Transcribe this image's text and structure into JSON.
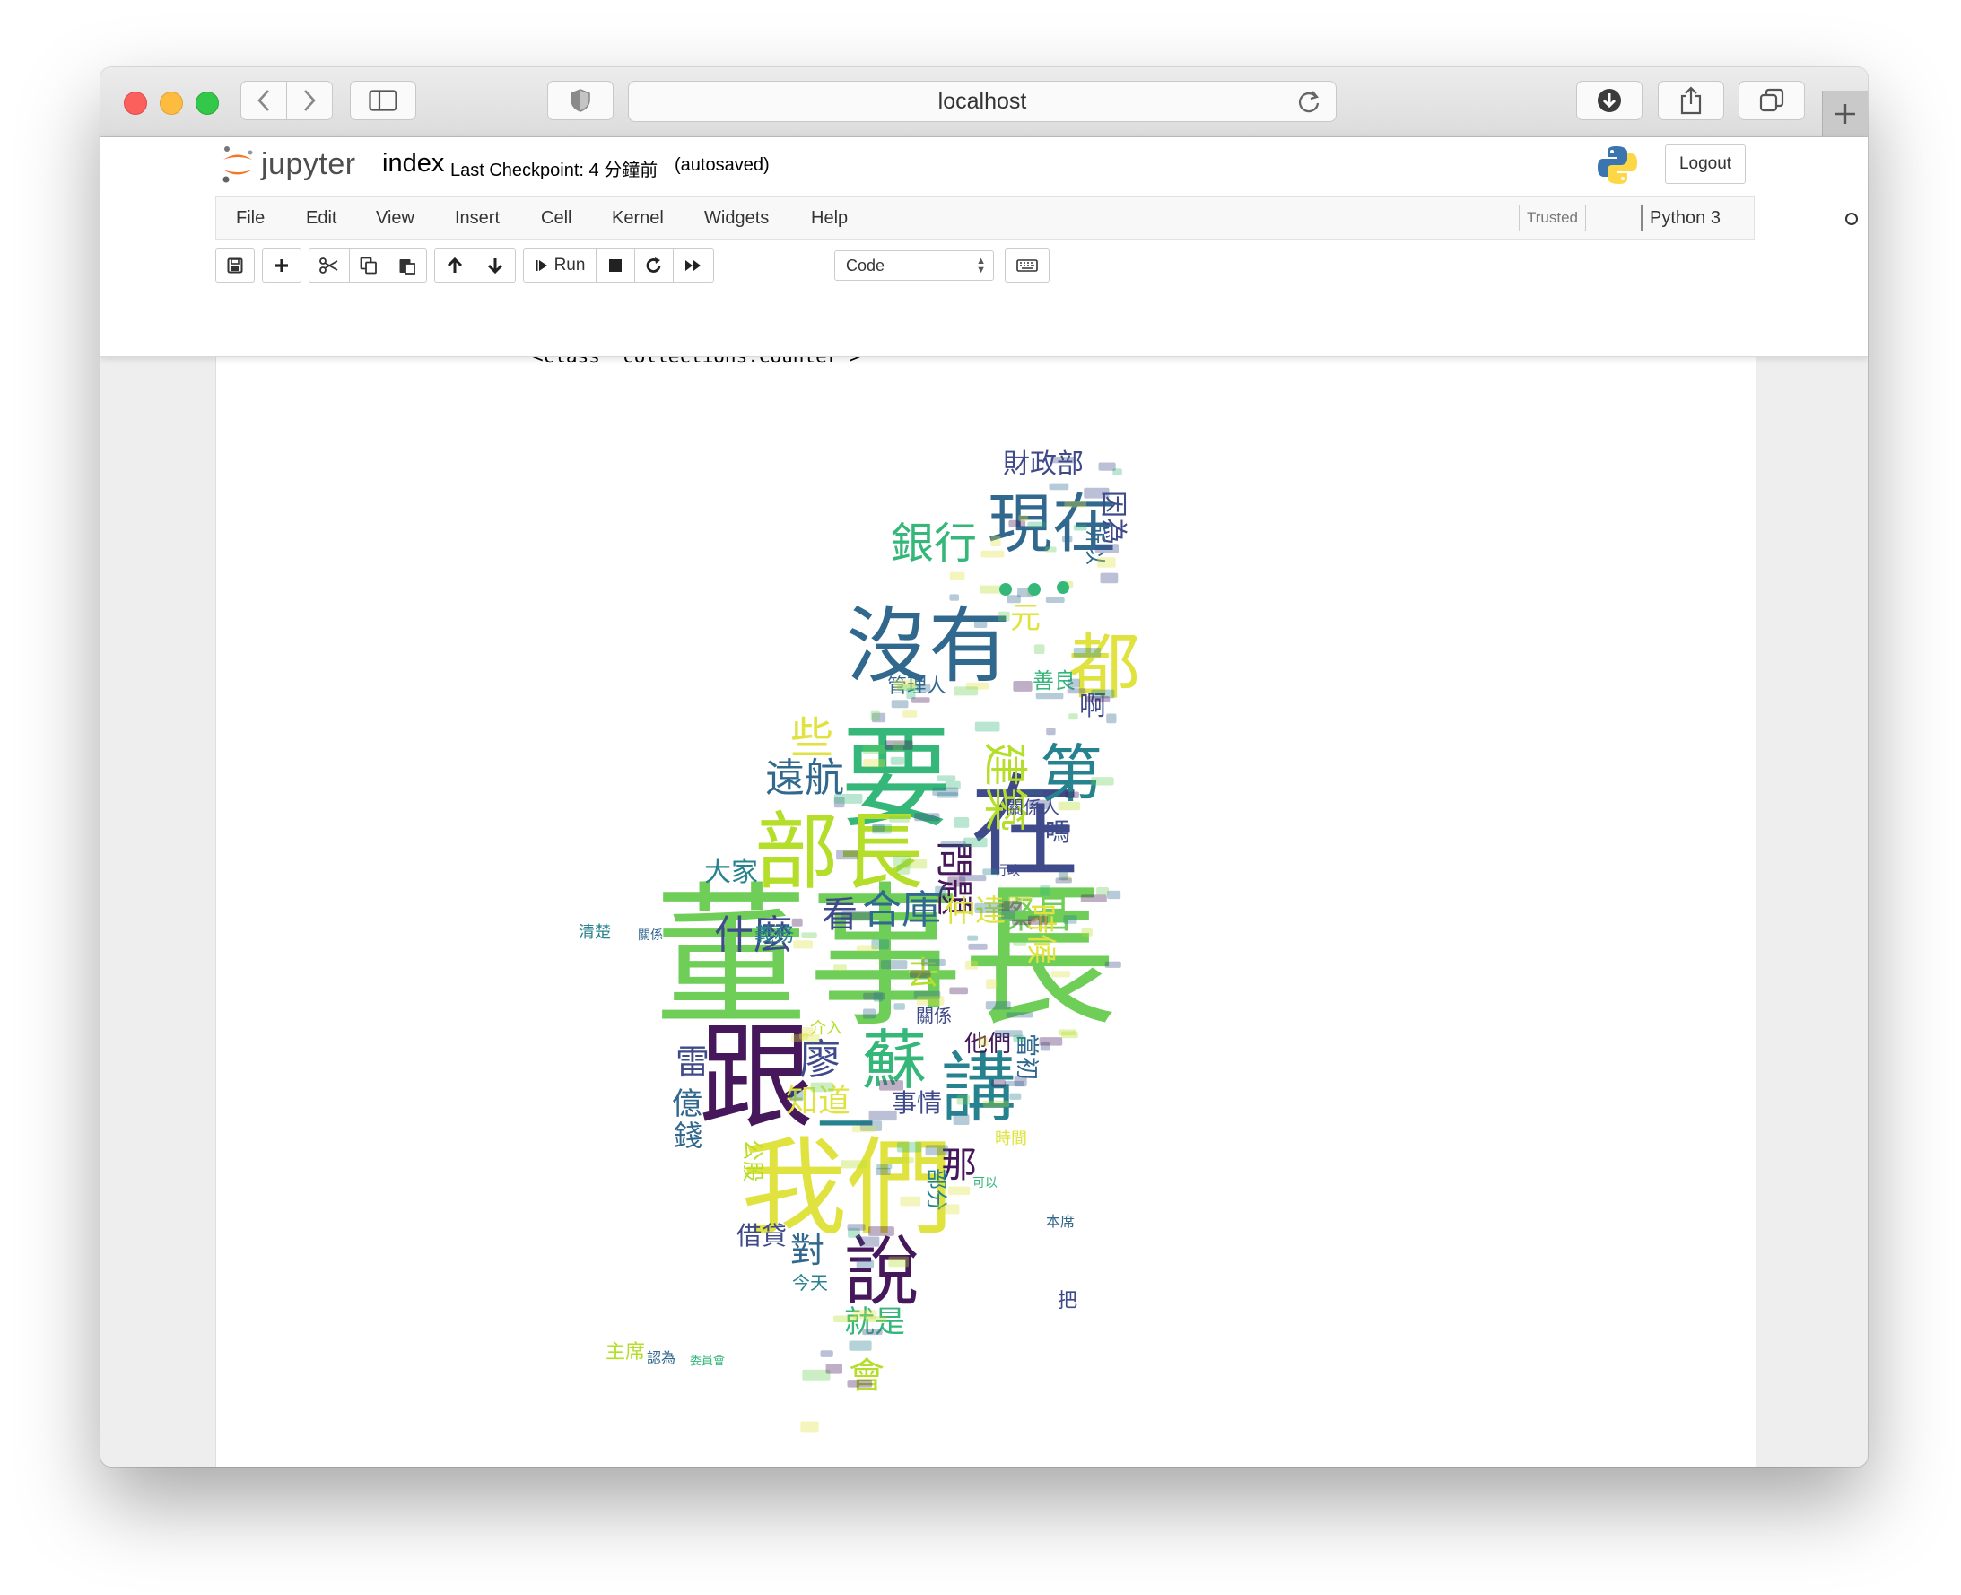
{
  "browser": {
    "url": "localhost"
  },
  "jupyter": {
    "logo_text": "jupyter",
    "notebook_name": "index",
    "checkpoint": "Last Checkpoint: 4 分鐘前",
    "autosave": "(autosaved)",
    "logout": "Logout",
    "menu": [
      "File",
      "Edit",
      "View",
      "Insert",
      "Cell",
      "Kernel",
      "Widgets",
      "Help"
    ],
    "trusted": "Trusted",
    "kernel": "Python 3",
    "toolbar": {
      "run_label": "Run",
      "cell_type": "Code"
    }
  },
  "output": {
    "class_text": "<class 'collections.Counter'>"
  },
  "wordcloud": {
    "colors": {
      "dark_purple": "#46185b",
      "indigo": "#3f4a8a",
      "blue": "#31688e",
      "teal": "#26828e",
      "green": "#35b779",
      "light_green": "#6ece58",
      "lime": "#b5de2b",
      "yellow": "#e0e33f"
    },
    "words": [
      "董事長",
      "我們",
      "跟",
      "要",
      "在",
      "沒有",
      "部長",
      "現在",
      "都",
      "講",
      "說",
      "蘇",
      "第",
      "一",
      "銀行",
      "建築",
      "遠航",
      "合庫",
      "燦昌",
      "什麼",
      "問題",
      "大家",
      "些",
      "財政部",
      "廖",
      "雷",
      "億",
      "錢",
      "知道",
      "事情",
      "那",
      "就是",
      "會",
      "今天",
      "對",
      "借貸",
      "看",
      "仲達",
      "時候",
      "去",
      "因為",
      "所以",
      "元",
      "啊",
      "嗎",
      "善良",
      "他們",
      "當初",
      "介入",
      "公股",
      "部分",
      "管理人",
      "關係人",
      "關係",
      "義務",
      "清楚",
      "主席",
      "認為",
      "委員會",
      "把",
      "本席",
      "可以",
      "時間",
      "關係",
      "行政"
    ]
  }
}
